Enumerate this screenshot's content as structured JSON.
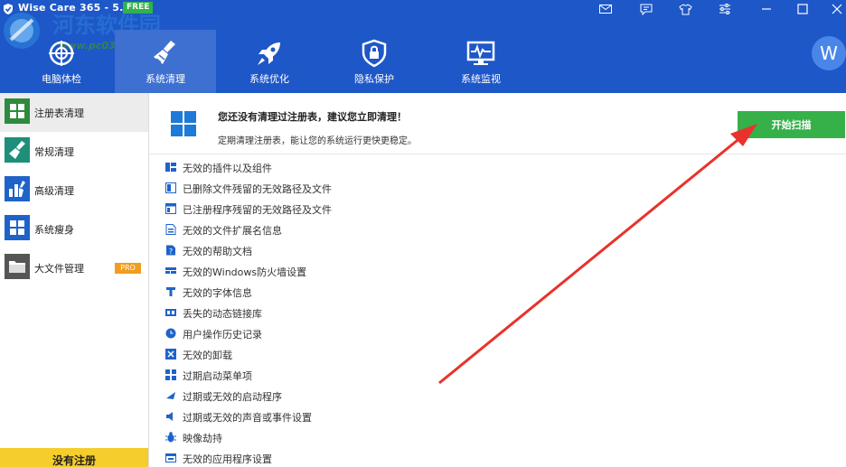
{
  "window": {
    "title": "Wise Care 365",
    "version": "- 5.4.8",
    "badge": "FREE",
    "watermark_text": "河东软件园",
    "watermark_url": "www.pc0359.cn"
  },
  "nav": {
    "tabs": [
      {
        "label": "电脑体检",
        "icon": "health-check-icon"
      },
      {
        "label": "系统清理",
        "icon": "broom-icon",
        "active": true
      },
      {
        "label": "系统优化",
        "icon": "rocket-icon"
      },
      {
        "label": "隐私保护",
        "icon": "shield-lock-icon"
      },
      {
        "label": "系统监视",
        "icon": "monitor-pulse-icon"
      }
    ],
    "avatar_letter": "W"
  },
  "sidebar": {
    "items": [
      {
        "label": "注册表清理",
        "icon": "registry-grid-icon",
        "color": "#2e8b3d",
        "active": true
      },
      {
        "label": "常规清理",
        "icon": "broom-icon",
        "color": "#1d8f7a"
      },
      {
        "label": "高级清理",
        "icon": "chart-broom-icon",
        "color": "#1e63c9"
      },
      {
        "label": "系统瘦身",
        "icon": "windows-icon",
        "color": "#1e63c9"
      },
      {
        "label": "大文件管理",
        "icon": "folder-icon",
        "color": "#555555",
        "badge": "PRO"
      }
    ],
    "register_label": "没有注册"
  },
  "banner": {
    "icon": "windows-tiles-icon",
    "title": "您还没有清理过注册表，建议您立即清理！",
    "subtitle": "定期清理注册表，能让您的系统运行更快更稳定。",
    "scan_label": "开始扫描"
  },
  "items": [
    {
      "label": "无效的插件以及组件",
      "icon": "plugin-icon"
    },
    {
      "label": "已删除文件残留的无效路径及文件",
      "icon": "file-path-icon"
    },
    {
      "label": "已注册程序残留的无效路径及文件",
      "icon": "app-path-icon"
    },
    {
      "label": "无效的文件扩展名信息",
      "icon": "file-ext-icon"
    },
    {
      "label": "无效的帮助文档",
      "icon": "help-doc-icon"
    },
    {
      "label": "无效的Windows防火墙设置",
      "icon": "firewall-icon"
    },
    {
      "label": "无效的字体信息",
      "icon": "font-icon"
    },
    {
      "label": "丢失的动态链接库",
      "icon": "dll-icon"
    },
    {
      "label": "用户操作历史记录",
      "icon": "history-icon"
    },
    {
      "label": "无效的卸载",
      "icon": "uninstall-icon"
    },
    {
      "label": "过期启动菜单项",
      "icon": "start-menu-icon"
    },
    {
      "label": "过期或无效的启动程序",
      "icon": "startup-icon"
    },
    {
      "label": "过期或无效的声音或事件设置",
      "icon": "sound-icon"
    },
    {
      "label": "映像劫持",
      "icon": "bug-icon"
    },
    {
      "label": "无效的应用程序设置",
      "icon": "app-settings-icon"
    }
  ],
  "colors": {
    "header": "#1e57c8",
    "active_tab": "#3d70d1",
    "scan_button": "#36b14a",
    "annotation_arrow": "#e8322b",
    "register_bar": "#f5cd2c"
  }
}
